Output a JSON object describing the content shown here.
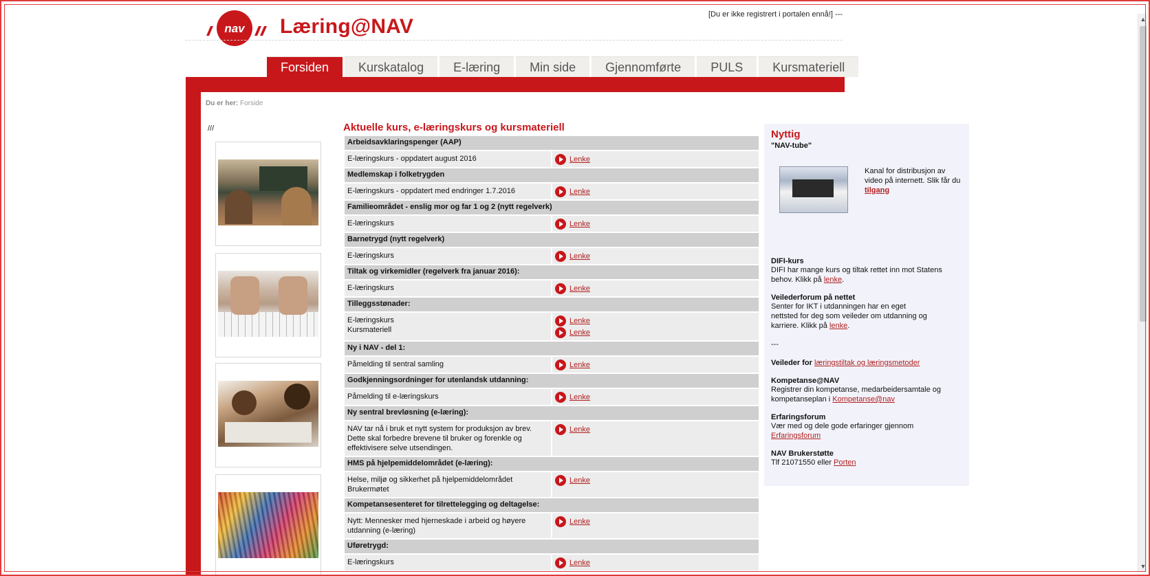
{
  "header": {
    "logo_text": "nav",
    "site_title": "Læring@NAV",
    "login_note": "[Du er ikke registrert i portalen ennå!] ---"
  },
  "nav": {
    "tabs": [
      "Forsiden",
      "Kurskatalog",
      "E-læring",
      "Min side",
      "Gjennomførte",
      "PULS",
      "Kursmateriell"
    ],
    "active": "Forsiden"
  },
  "breadcrumb": {
    "prefix": "Du er her:",
    "current": "Forside"
  },
  "left": {
    "slashes": "///"
  },
  "main": {
    "heading": "Aktuelle kurs, e-læringskurs og kursmateriell",
    "sections": [
      {
        "title": "Arbeidsavklaringspenger (AAP)",
        "rows": [
          {
            "desc": [
              "E-læringskurs - oppdatert  august 2016"
            ],
            "links": [
              "Lenke"
            ]
          }
        ]
      },
      {
        "title": "Medlemskap i folketrygden",
        "rows": [
          {
            "desc": [
              "E-læringskurs - oppdatert med endringer 1.7.2016"
            ],
            "links": [
              "Lenke"
            ]
          }
        ]
      },
      {
        "title": "Familieområdet - enslig mor og far 1 og 2 (nytt regelverk)",
        "rows": [
          {
            "desc": [
              "E-læringskurs"
            ],
            "links": [
              "Lenke"
            ]
          }
        ]
      },
      {
        "title": "Barnetrygd (nytt regelverk)",
        "rows": [
          {
            "desc": [
              "E-læringskurs"
            ],
            "links": [
              "Lenke"
            ]
          }
        ]
      },
      {
        "title": "Tiltak og virkemidler (regelverk fra januar 2016):",
        "rows": [
          {
            "desc": [
              "E-læringskurs"
            ],
            "links": [
              "Lenke"
            ]
          }
        ]
      },
      {
        "title": "Tilleggsstønader:",
        "rows": [
          {
            "desc": [
              "E-læringskurs",
              "Kursmateriell"
            ],
            "links": [
              "Lenke",
              "Lenke"
            ]
          }
        ]
      },
      {
        "title": "Ny i NAV - del 1:",
        "rows": [
          {
            "desc": [
              "Påmelding til sentral samling"
            ],
            "links": [
              "Lenke"
            ]
          }
        ]
      },
      {
        "title": "Godkjenningsordninger for utenlandsk utdanning:",
        "rows": [
          {
            "desc": [
              "Påmelding til e-læringskurs"
            ],
            "links": [
              "Lenke"
            ]
          }
        ]
      },
      {
        "title": "Ny sentral brevløsning (e-læring):",
        "rows": [
          {
            "desc": [
              "NAV tar nå i bruk et nytt system for produksjon av brev. Dette skal forbedre brevene til bruker og forenkle og effektivisere selve utsendingen."
            ],
            "links": [
              "Lenke"
            ]
          }
        ]
      },
      {
        "title": "HMS på hjelpemiddelområdet (e-læring):",
        "rows": [
          {
            "desc": [
              "Helse, miljø og sikkerhet på hjelpemiddelområdet",
              "Brukermøtet"
            ],
            "links": [
              "Lenke"
            ]
          }
        ]
      },
      {
        "title": "Kompetansesenteret for tilrettelegging og deltagelse:",
        "rows": [
          {
            "desc": [
              "Nytt: Mennesker med hjerneskade i arbeid og høyere utdanning (e-læring)"
            ],
            "links": [
              "Lenke"
            ]
          }
        ]
      },
      {
        "title": "Uføretrygd:",
        "rows": [
          {
            "desc": [
              "E-læringskurs"
            ],
            "links": [
              "Lenke"
            ]
          }
        ]
      }
    ]
  },
  "sidebar": {
    "title": "Nyttig",
    "tube_title": "\"NAV-tube\"",
    "tube_text": "Kanal for distribusjon av video på internett. Slik får du",
    "tube_link": "tilgang",
    "difi": {
      "head": "DIFI-kurs",
      "text": "DIFI har mange kurs og tiltak rettet inn mot Statens behov. Klikk på",
      "link": "lenke",
      "tail": "."
    },
    "veileder": {
      "head": "Veilederforum på nettet",
      "text": "Senter for IKT i utdanningen har en eget nettsted for deg som veileder om utdanning og karriere. Klikk på",
      "link": "lenke",
      "tail": "."
    },
    "dashes": "---",
    "veileder_for": {
      "head": "Veileder for",
      "link": "læringstiltak og læringsmetoder"
    },
    "kompetanse": {
      "head": "Kompetanse@NAV",
      "text": "Registrer din kompetanse, medarbeidersamtale og kompetanseplan i",
      "link": "Kompetanse@nav"
    },
    "erfaring": {
      "head": "Erfaringsforum",
      "text": "Vær med og dele gode erfaringer gjennom",
      "link": "Erfaringsforum"
    },
    "brukerstotte": {
      "head": "NAV Brukerstøtte",
      "text": "Tlf 21071550 eller",
      "link": "Porten"
    }
  },
  "colors": {
    "brand_red": "#c8171b",
    "section_grey": "#cfcfcf",
    "row_grey": "#ececec",
    "sidebar_bg": "#f2f3fa"
  }
}
